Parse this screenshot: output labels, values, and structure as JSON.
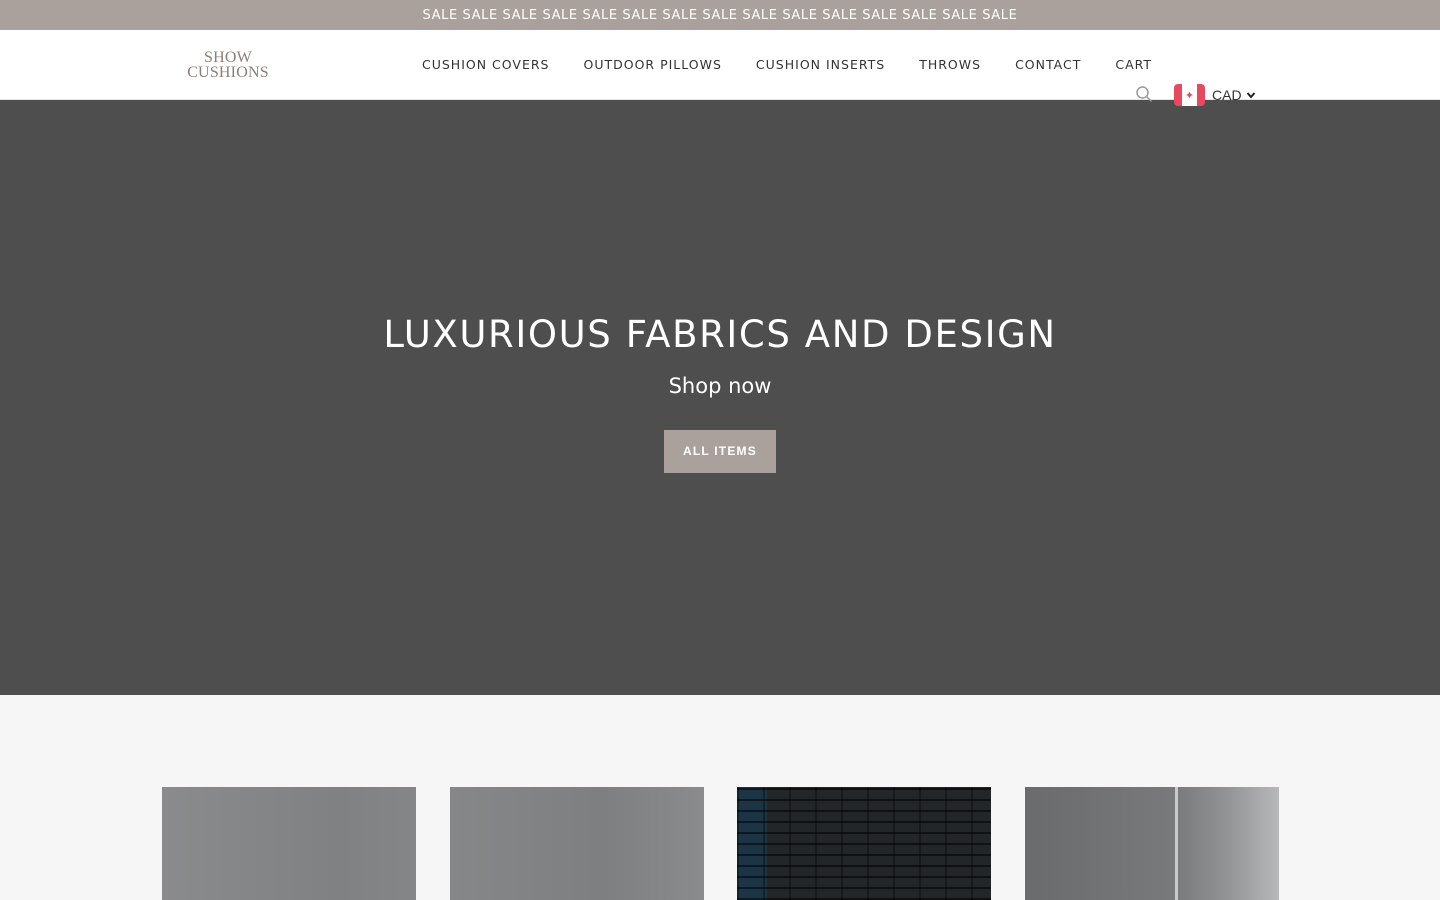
{
  "announcement": {
    "text": "SALE SALE SALE SALE SALE SALE SALE SALE SALE SALE SALE SALE SALE SALE SALE"
  },
  "header": {
    "logo": {
      "line1": "SHOW",
      "line2": "CUSHIONS"
    },
    "nav": [
      {
        "label": "CUSHION COVERS"
      },
      {
        "label": "OUTDOOR PILLOWS"
      },
      {
        "label": "CUSHION INSERTS"
      },
      {
        "label": "THROWS"
      },
      {
        "label": "CONTACT"
      },
      {
        "label": "CART"
      }
    ],
    "search_icon": "search-icon",
    "currency": {
      "code": "CAD",
      "flag": "canada-flag-icon"
    }
  },
  "hero": {
    "title": "LUXURIOUS FABRICS AND DESIGN",
    "subtitle": "Shop now",
    "button_label": "ALL ITEMS"
  },
  "colors": {
    "accent": "#aba19c",
    "hero_bg": "#4e4e4e",
    "logo": "#8e7f76",
    "page_bg": "#f6f6f6"
  }
}
